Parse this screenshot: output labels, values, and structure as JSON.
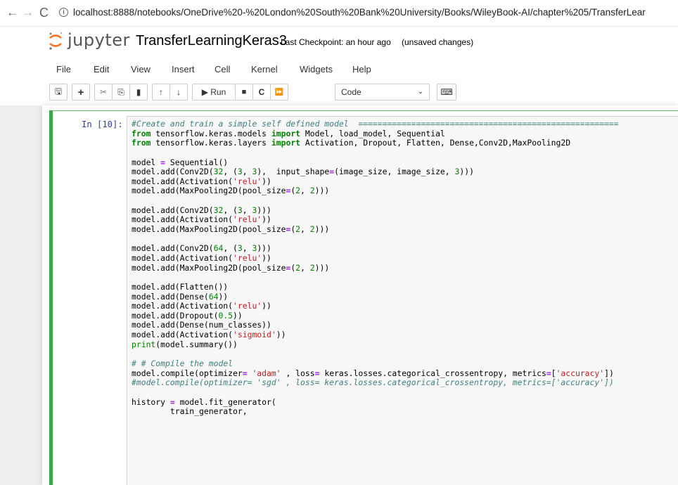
{
  "browser": {
    "back_icon": "←",
    "forward_icon": "→",
    "reload_icon": "C",
    "info_icon": "i",
    "url": "localhost:8888/notebooks/OneDrive%20-%20London%20South%20Bank%20University/Books/WileyBook-AI/chapter%205/TransferLear"
  },
  "header": {
    "logo_text": "jupyter",
    "notebook_name": "TransferLearningKeras3",
    "checkpoint": "Last Checkpoint: an hour ago",
    "unsaved": "(unsaved changes)"
  },
  "menu": [
    "File",
    "Edit",
    "View",
    "Insert",
    "Cell",
    "Kernel",
    "Widgets",
    "Help"
  ],
  "toolbar": {
    "save_icon": "🖫",
    "add_icon": "+",
    "cut_icon": "✂",
    "copy_icon": "⎘",
    "paste_icon": "▮",
    "up_icon": "↑",
    "down_icon": "↓",
    "run_label": "▶ Run",
    "stop_icon": "■",
    "restart_icon": "C",
    "restart_run_icon": "⏩",
    "cell_type": "Code",
    "caret": "⌄",
    "keyboard_icon": "⌨"
  },
  "cell": {
    "prompt": "In [10]:",
    "lines": [
      [
        {
          "t": "#Create and train a simple self defined model  ======================================================",
          "c": "cm"
        }
      ],
      [
        {
          "t": "from",
          "c": "kw"
        },
        {
          "t": " tensorflow.keras.models ",
          "c": ""
        },
        {
          "t": "import",
          "c": "kw"
        },
        {
          "t": " Model, load_model, Sequential",
          "c": ""
        }
      ],
      [
        {
          "t": "from",
          "c": "kw"
        },
        {
          "t": " tensorflow.keras.layers ",
          "c": ""
        },
        {
          "t": "import",
          "c": "kw"
        },
        {
          "t": " Activation, Dropout, Flatten, Dense,Conv2D,MaxPooling2D",
          "c": ""
        }
      ],
      [
        {
          "t": "",
          "c": ""
        }
      ],
      [
        {
          "t": "model ",
          "c": ""
        },
        {
          "t": "=",
          "c": "op"
        },
        {
          "t": " Sequential()",
          "c": ""
        }
      ],
      [
        {
          "t": "model.add(Conv2D(",
          "c": ""
        },
        {
          "t": "32",
          "c": "nm"
        },
        {
          "t": ", (",
          "c": ""
        },
        {
          "t": "3",
          "c": "nm"
        },
        {
          "t": ", ",
          "c": ""
        },
        {
          "t": "3",
          "c": "nm"
        },
        {
          "t": "),  input_shape",
          "c": ""
        },
        {
          "t": "=",
          "c": "op"
        },
        {
          "t": "(image_size, image_size, ",
          "c": ""
        },
        {
          "t": "3",
          "c": "nm"
        },
        {
          "t": ")))",
          "c": ""
        }
      ],
      [
        {
          "t": "model.add(Activation(",
          "c": ""
        },
        {
          "t": "'relu'",
          "c": "st"
        },
        {
          "t": "))",
          "c": ""
        }
      ],
      [
        {
          "t": "model.add(MaxPooling2D(pool_size",
          "c": ""
        },
        {
          "t": "=",
          "c": "op"
        },
        {
          "t": "(",
          "c": ""
        },
        {
          "t": "2",
          "c": "nm"
        },
        {
          "t": ", ",
          "c": ""
        },
        {
          "t": "2",
          "c": "nm"
        },
        {
          "t": ")))",
          "c": ""
        }
      ],
      [
        {
          "t": "",
          "c": ""
        }
      ],
      [
        {
          "t": "model.add(Conv2D(",
          "c": ""
        },
        {
          "t": "32",
          "c": "nm"
        },
        {
          "t": ", (",
          "c": ""
        },
        {
          "t": "3",
          "c": "nm"
        },
        {
          "t": ", ",
          "c": ""
        },
        {
          "t": "3",
          "c": "nm"
        },
        {
          "t": ")))",
          "c": ""
        }
      ],
      [
        {
          "t": "model.add(Activation(",
          "c": ""
        },
        {
          "t": "'relu'",
          "c": "st"
        },
        {
          "t": "))",
          "c": ""
        }
      ],
      [
        {
          "t": "model.add(MaxPooling2D(pool_size",
          "c": ""
        },
        {
          "t": "=",
          "c": "op"
        },
        {
          "t": "(",
          "c": ""
        },
        {
          "t": "2",
          "c": "nm"
        },
        {
          "t": ", ",
          "c": ""
        },
        {
          "t": "2",
          "c": "nm"
        },
        {
          "t": ")))",
          "c": ""
        }
      ],
      [
        {
          "t": "",
          "c": ""
        }
      ],
      [
        {
          "t": "model.add(Conv2D(",
          "c": ""
        },
        {
          "t": "64",
          "c": "nm"
        },
        {
          "t": ", (",
          "c": ""
        },
        {
          "t": "3",
          "c": "nm"
        },
        {
          "t": ", ",
          "c": ""
        },
        {
          "t": "3",
          "c": "nm"
        },
        {
          "t": ")))",
          "c": ""
        }
      ],
      [
        {
          "t": "model.add(Activation(",
          "c": ""
        },
        {
          "t": "'relu'",
          "c": "st"
        },
        {
          "t": "))",
          "c": ""
        }
      ],
      [
        {
          "t": "model.add(MaxPooling2D(pool_size",
          "c": ""
        },
        {
          "t": "=",
          "c": "op"
        },
        {
          "t": "(",
          "c": ""
        },
        {
          "t": "2",
          "c": "nm"
        },
        {
          "t": ", ",
          "c": ""
        },
        {
          "t": "2",
          "c": "nm"
        },
        {
          "t": ")))",
          "c": ""
        }
      ],
      [
        {
          "t": "",
          "c": ""
        }
      ],
      [
        {
          "t": "model.add(Flatten())",
          "c": ""
        }
      ],
      [
        {
          "t": "model.add(Dense(",
          "c": ""
        },
        {
          "t": "64",
          "c": "nm"
        },
        {
          "t": "))",
          "c": ""
        }
      ],
      [
        {
          "t": "model.add(Activation(",
          "c": ""
        },
        {
          "t": "'relu'",
          "c": "st"
        },
        {
          "t": "))",
          "c": ""
        }
      ],
      [
        {
          "t": "model.add(Dropout(",
          "c": ""
        },
        {
          "t": "0.5",
          "c": "nm"
        },
        {
          "t": "))",
          "c": ""
        }
      ],
      [
        {
          "t": "model.add(Dense(num_classes))",
          "c": ""
        }
      ],
      [
        {
          "t": "model.add(Activation(",
          "c": ""
        },
        {
          "t": "'sigmoid'",
          "c": "st"
        },
        {
          "t": "))",
          "c": ""
        }
      ],
      [
        {
          "t": "print",
          "c": "nm"
        },
        {
          "t": "(model.summary())",
          "c": ""
        }
      ],
      [
        {
          "t": "",
          "c": ""
        }
      ],
      [
        {
          "t": "# # Compile the model",
          "c": "cm"
        }
      ],
      [
        {
          "t": "model.compile(optimizer",
          "c": ""
        },
        {
          "t": "=",
          "c": "op"
        },
        {
          "t": " ",
          "c": ""
        },
        {
          "t": "'adam'",
          "c": "st"
        },
        {
          "t": " , loss",
          "c": ""
        },
        {
          "t": "=",
          "c": "op"
        },
        {
          "t": " keras.losses.categorical_crossentropy, metrics",
          "c": ""
        },
        {
          "t": "=",
          "c": "op"
        },
        {
          "t": "[",
          "c": ""
        },
        {
          "t": "'accuracy'",
          "c": "st"
        },
        {
          "t": "])",
          "c": ""
        }
      ],
      [
        {
          "t": "#model.compile(optimizer= 'sgd' , loss= keras.losses.categorical_crossentropy, metrics=['accuracy'])",
          "c": "cm"
        }
      ],
      [
        {
          "t": "",
          "c": ""
        }
      ],
      [
        {
          "t": "history ",
          "c": ""
        },
        {
          "t": "=",
          "c": "op"
        },
        {
          "t": " model.fit_generator(",
          "c": ""
        }
      ],
      [
        {
          "t": "        train_generator,",
          "c": ""
        }
      ]
    ]
  }
}
